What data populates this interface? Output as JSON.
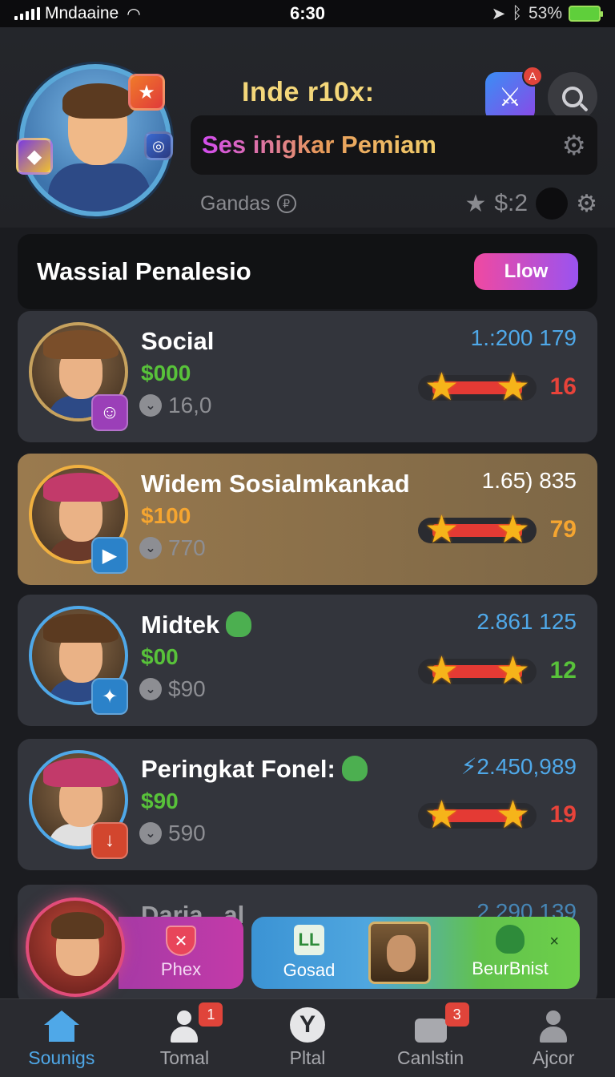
{
  "status_bar": {
    "carrier": "Mndaaine",
    "time": "6:30",
    "battery": "53%"
  },
  "header": {
    "app_title": "Inde r10x:",
    "game_badge": "A",
    "rank_banner": "Ses inigkar Pemiam",
    "sub_label": "Gandas",
    "sub_value": "$:2"
  },
  "section": {
    "title": "Wassial Penalesio",
    "button_label": "Llow"
  },
  "cards": [
    {
      "name": "Social",
      "money": "$000",
      "sub": "16,0",
      "score": "1.:200 179",
      "count": "16",
      "count_color": "#e8433a",
      "accent": "#c7a25e",
      "hat": "#7a4e2a",
      "torso": "#2d4a86",
      "badge_color": "#9b3fb8",
      "badge_icon": "user-icon",
      "highlight": false
    },
    {
      "name": "Widem Sosialmkankad",
      "money": "$100",
      "sub": "770",
      "score": "1.65) 835",
      "count": "79",
      "count_color": "#f5a530",
      "accent": "#f0b040",
      "hat": "#c23a6a",
      "torso": "#6a3a2a",
      "badge_color": "#2b82c9",
      "badge_icon": "play-icon",
      "highlight": true
    },
    {
      "name": "Midtek",
      "money": "$00",
      "sub": "$90",
      "score": "2.861 125",
      "count": "12",
      "count_color": "#58c23a",
      "accent": "#4fa8e8",
      "hat": "#5b3a20",
      "torso": "#2d4a86",
      "badge_color": "#2b82c9",
      "badge_icon": "mixed-icon",
      "highlight": false,
      "blob": true
    },
    {
      "name": "Peringkat Fonel:",
      "money": "$90",
      "sub": "590",
      "score": "⚡2.450,989",
      "count": "19",
      "count_color": "#e8433a",
      "accent": "#4fa8e8",
      "hat": "#c23a6a",
      "torso": "#e0e0e0",
      "badge_color": "#d2462e",
      "badge_icon": "chevron-down-icon",
      "highlight": false,
      "blob": true
    }
  ],
  "partial_card": {
    "name": "Daria...al",
    "score": "2.290 139"
  },
  "bottom_pills": {
    "phex": "Phex",
    "gosad": "Gosad",
    "gosad_icon": "LL",
    "beur": "BeurBnist"
  },
  "tabs": [
    {
      "label": "Sounigs",
      "icon": "home-icon",
      "badge": ""
    },
    {
      "label": "Tomal",
      "icon": "person-icon",
      "badge": "1"
    },
    {
      "label": "Pltal",
      "icon": "y-icon",
      "badge": ""
    },
    {
      "label": "Canlstin",
      "icon": "card-icon",
      "badge": "3"
    },
    {
      "label": "Ajcor",
      "icon": "person-icon",
      "badge": ""
    }
  ],
  "colors": {
    "accent_blue": "#4fa8e8",
    "accent_pink": "#f049a1",
    "accent_purple": "#9a53f0",
    "money_green": "#58c23a",
    "star_gold": "#f6b41a",
    "bar_red": "#e43a34"
  }
}
